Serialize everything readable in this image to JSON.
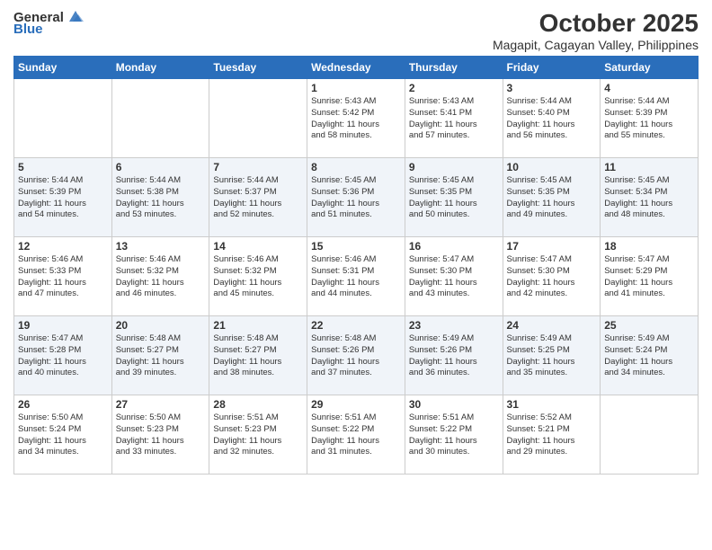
{
  "header": {
    "logo_general": "General",
    "logo_blue": "Blue",
    "title": "October 2025",
    "subtitle": "Magapit, Cagayan Valley, Philippines"
  },
  "days": [
    "Sunday",
    "Monday",
    "Tuesday",
    "Wednesday",
    "Thursday",
    "Friday",
    "Saturday"
  ],
  "weeks": [
    [
      {
        "day": "",
        "content": ""
      },
      {
        "day": "",
        "content": ""
      },
      {
        "day": "",
        "content": ""
      },
      {
        "day": "1",
        "content": "Sunrise: 5:43 AM\nSunset: 5:42 PM\nDaylight: 11 hours\nand 58 minutes."
      },
      {
        "day": "2",
        "content": "Sunrise: 5:43 AM\nSunset: 5:41 PM\nDaylight: 11 hours\nand 57 minutes."
      },
      {
        "day": "3",
        "content": "Sunrise: 5:44 AM\nSunset: 5:40 PM\nDaylight: 11 hours\nand 56 minutes."
      },
      {
        "day": "4",
        "content": "Sunrise: 5:44 AM\nSunset: 5:39 PM\nDaylight: 11 hours\nand 55 minutes."
      }
    ],
    [
      {
        "day": "5",
        "content": "Sunrise: 5:44 AM\nSunset: 5:39 PM\nDaylight: 11 hours\nand 54 minutes."
      },
      {
        "day": "6",
        "content": "Sunrise: 5:44 AM\nSunset: 5:38 PM\nDaylight: 11 hours\nand 53 minutes."
      },
      {
        "day": "7",
        "content": "Sunrise: 5:44 AM\nSunset: 5:37 PM\nDaylight: 11 hours\nand 52 minutes."
      },
      {
        "day": "8",
        "content": "Sunrise: 5:45 AM\nSunset: 5:36 PM\nDaylight: 11 hours\nand 51 minutes."
      },
      {
        "day": "9",
        "content": "Sunrise: 5:45 AM\nSunset: 5:35 PM\nDaylight: 11 hours\nand 50 minutes."
      },
      {
        "day": "10",
        "content": "Sunrise: 5:45 AM\nSunset: 5:35 PM\nDaylight: 11 hours\nand 49 minutes."
      },
      {
        "day": "11",
        "content": "Sunrise: 5:45 AM\nSunset: 5:34 PM\nDaylight: 11 hours\nand 48 minutes."
      }
    ],
    [
      {
        "day": "12",
        "content": "Sunrise: 5:46 AM\nSunset: 5:33 PM\nDaylight: 11 hours\nand 47 minutes."
      },
      {
        "day": "13",
        "content": "Sunrise: 5:46 AM\nSunset: 5:32 PM\nDaylight: 11 hours\nand 46 minutes."
      },
      {
        "day": "14",
        "content": "Sunrise: 5:46 AM\nSunset: 5:32 PM\nDaylight: 11 hours\nand 45 minutes."
      },
      {
        "day": "15",
        "content": "Sunrise: 5:46 AM\nSunset: 5:31 PM\nDaylight: 11 hours\nand 44 minutes."
      },
      {
        "day": "16",
        "content": "Sunrise: 5:47 AM\nSunset: 5:30 PM\nDaylight: 11 hours\nand 43 minutes."
      },
      {
        "day": "17",
        "content": "Sunrise: 5:47 AM\nSunset: 5:30 PM\nDaylight: 11 hours\nand 42 minutes."
      },
      {
        "day": "18",
        "content": "Sunrise: 5:47 AM\nSunset: 5:29 PM\nDaylight: 11 hours\nand 41 minutes."
      }
    ],
    [
      {
        "day": "19",
        "content": "Sunrise: 5:47 AM\nSunset: 5:28 PM\nDaylight: 11 hours\nand 40 minutes."
      },
      {
        "day": "20",
        "content": "Sunrise: 5:48 AM\nSunset: 5:27 PM\nDaylight: 11 hours\nand 39 minutes."
      },
      {
        "day": "21",
        "content": "Sunrise: 5:48 AM\nSunset: 5:27 PM\nDaylight: 11 hours\nand 38 minutes."
      },
      {
        "day": "22",
        "content": "Sunrise: 5:48 AM\nSunset: 5:26 PM\nDaylight: 11 hours\nand 37 minutes."
      },
      {
        "day": "23",
        "content": "Sunrise: 5:49 AM\nSunset: 5:26 PM\nDaylight: 11 hours\nand 36 minutes."
      },
      {
        "day": "24",
        "content": "Sunrise: 5:49 AM\nSunset: 5:25 PM\nDaylight: 11 hours\nand 35 minutes."
      },
      {
        "day": "25",
        "content": "Sunrise: 5:49 AM\nSunset: 5:24 PM\nDaylight: 11 hours\nand 34 minutes."
      }
    ],
    [
      {
        "day": "26",
        "content": "Sunrise: 5:50 AM\nSunset: 5:24 PM\nDaylight: 11 hours\nand 34 minutes."
      },
      {
        "day": "27",
        "content": "Sunrise: 5:50 AM\nSunset: 5:23 PM\nDaylight: 11 hours\nand 33 minutes."
      },
      {
        "day": "28",
        "content": "Sunrise: 5:51 AM\nSunset: 5:23 PM\nDaylight: 11 hours\nand 32 minutes."
      },
      {
        "day": "29",
        "content": "Sunrise: 5:51 AM\nSunset: 5:22 PM\nDaylight: 11 hours\nand 31 minutes."
      },
      {
        "day": "30",
        "content": "Sunrise: 5:51 AM\nSunset: 5:22 PM\nDaylight: 11 hours\nand 30 minutes."
      },
      {
        "day": "31",
        "content": "Sunrise: 5:52 AM\nSunset: 5:21 PM\nDaylight: 11 hours\nand 29 minutes."
      },
      {
        "day": "",
        "content": ""
      }
    ]
  ]
}
